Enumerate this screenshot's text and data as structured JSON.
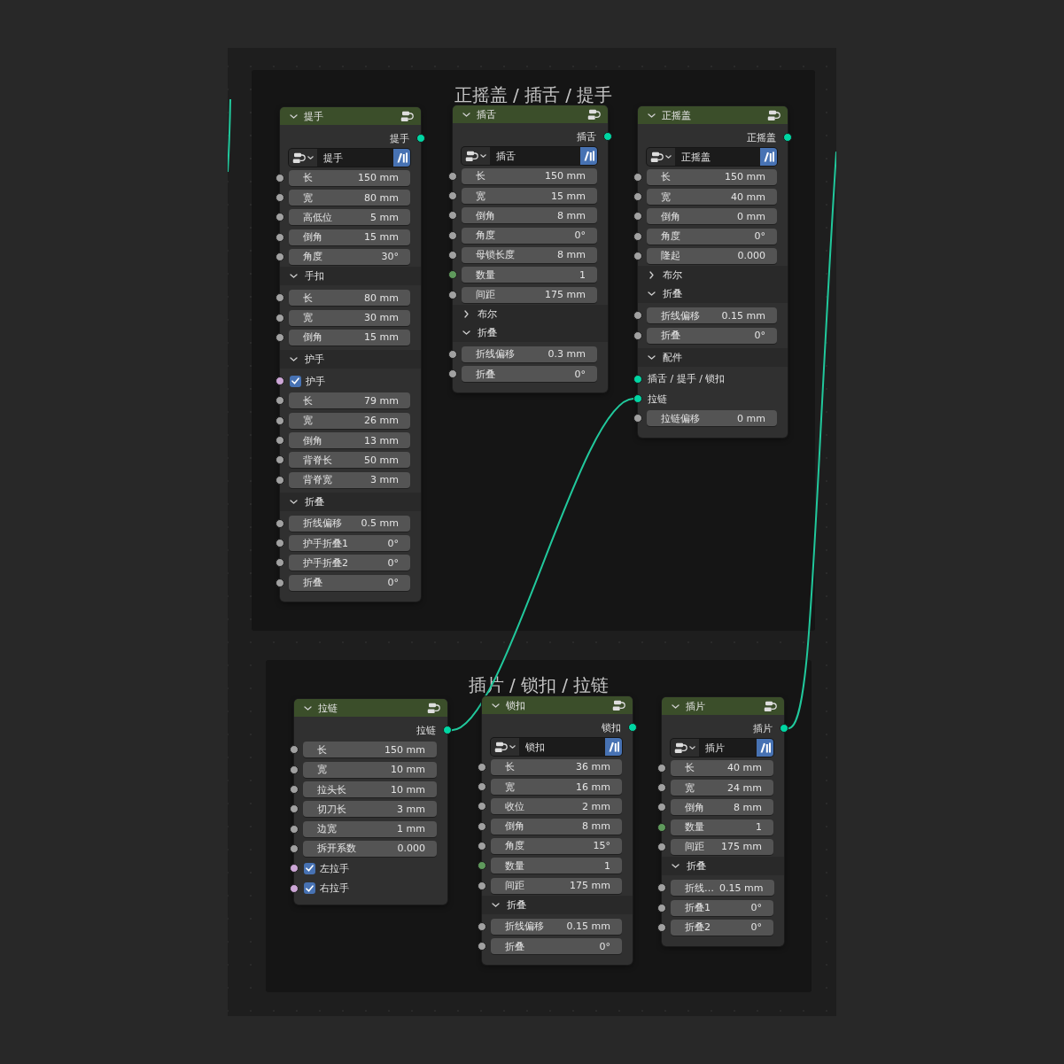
{
  "frames": [
    {
      "title": "正摇盖 / 插舌 / 提手",
      "nodes": [
        {
          "title": "提手",
          "expanded": true,
          "output": {
            "label": "提手",
            "color": "#00d6a3",
            "linked": false
          },
          "datablock": {
            "name": "提手",
            "asset": true
          },
          "items": [
            {
              "kind": "value",
              "label": "长",
              "value": "150 mm",
              "color": "#a1a1a1"
            },
            {
              "kind": "value",
              "label": "宽",
              "value": "80 mm",
              "color": "#a1a1a1"
            },
            {
              "kind": "value",
              "label": "高低位",
              "value": "5 mm",
              "color": "#a1a1a1"
            },
            {
              "kind": "value",
              "label": "倒角",
              "value": "15 mm",
              "color": "#a1a1a1"
            },
            {
              "kind": "value",
              "label": "角度",
              "value": "30°",
              "color": "#a1a1a1"
            },
            {
              "kind": "panel",
              "label": "手扣",
              "expanded": true,
              "children": [
                {
                  "kind": "value",
                  "label": "长",
                  "value": "80 mm",
                  "color": "#a1a1a1"
                },
                {
                  "kind": "value",
                  "label": "宽",
                  "value": "30 mm",
                  "color": "#a1a1a1"
                },
                {
                  "kind": "value",
                  "label": "倒角",
                  "value": "15 mm",
                  "color": "#a1a1a1"
                }
              ]
            },
            {
              "kind": "panel",
              "label": "护手",
              "expanded": true,
              "children": [
                {
                  "kind": "checkbox",
                  "label": "护手",
                  "checked": true,
                  "color": "#cca6d6"
                },
                {
                  "kind": "value",
                  "label": "长",
                  "value": "79 mm",
                  "color": "#a1a1a1"
                },
                {
                  "kind": "value",
                  "label": "宽",
                  "value": "26 mm",
                  "color": "#a1a1a1"
                },
                {
                  "kind": "value",
                  "label": "倒角",
                  "value": "13 mm",
                  "color": "#a1a1a1"
                },
                {
                  "kind": "value",
                  "label": "背脊长",
                  "value": "50 mm",
                  "color": "#a1a1a1"
                },
                {
                  "kind": "value",
                  "label": "背脊宽",
                  "value": "3 mm",
                  "color": "#a1a1a1"
                }
              ]
            },
            {
              "kind": "panel",
              "label": "折叠",
              "expanded": true,
              "children": [
                {
                  "kind": "value",
                  "label": "折线偏移",
                  "value": "0.5 mm",
                  "color": "#a1a1a1"
                },
                {
                  "kind": "value",
                  "label": "护手折叠1",
                  "value": "0°",
                  "color": "#a1a1a1"
                },
                {
                  "kind": "value",
                  "label": "护手折叠2",
                  "value": "0°",
                  "color": "#a1a1a1"
                },
                {
                  "kind": "value",
                  "label": "折叠",
                  "value": "0°",
                  "color": "#a1a1a1"
                }
              ]
            }
          ]
        },
        {
          "title": "插舌",
          "expanded": true,
          "output": {
            "label": "插舌",
            "color": "#00d6a3",
            "linked": false
          },
          "datablock": {
            "name": "插舌",
            "asset": true
          },
          "items": [
            {
              "kind": "value",
              "label": "长",
              "value": "150 mm",
              "color": "#a1a1a1"
            },
            {
              "kind": "value",
              "label": "宽",
              "value": "15 mm",
              "color": "#a1a1a1"
            },
            {
              "kind": "value",
              "label": "倒角",
              "value": "8 mm",
              "color": "#a1a1a1"
            },
            {
              "kind": "value",
              "label": "角度",
              "value": "0°",
              "color": "#a1a1a1"
            },
            {
              "kind": "value",
              "label": "母锁长度",
              "value": "8 mm",
              "color": "#a1a1a1"
            },
            {
              "kind": "value",
              "label": "数量",
              "value": "1",
              "color": "#5f9a5c"
            },
            {
              "kind": "value",
              "label": "间距",
              "value": "175 mm",
              "color": "#a1a1a1"
            },
            {
              "kind": "panel",
              "label": "布尔",
              "expanded": false
            },
            {
              "kind": "panel",
              "label": "折叠",
              "expanded": true,
              "children": [
                {
                  "kind": "value",
                  "label": "折线偏移",
                  "value": "0.3 mm",
                  "color": "#a1a1a1"
                },
                {
                  "kind": "value",
                  "label": "折叠",
                  "value": "0°",
                  "color": "#a1a1a1"
                }
              ]
            }
          ]
        },
        {
          "title": "正摇盖",
          "expanded": true,
          "output": {
            "label": "正摇盖",
            "color": "#00d6a3",
            "linked": false
          },
          "datablock": {
            "name": "正摇盖",
            "asset": true
          },
          "items": [
            {
              "kind": "value",
              "label": "长",
              "value": "150 mm",
              "color": "#a1a1a1"
            },
            {
              "kind": "value",
              "label": "宽",
              "value": "40 mm",
              "color": "#a1a1a1"
            },
            {
              "kind": "value",
              "label": "倒角",
              "value": "0 mm",
              "color": "#a1a1a1"
            },
            {
              "kind": "value",
              "label": "角度",
              "value": "0°",
              "color": "#a1a1a1"
            },
            {
              "kind": "value",
              "label": "隆起",
              "value": "0.000",
              "color": "#a1a1a1"
            },
            {
              "kind": "panel",
              "label": "布尔",
              "expanded": false
            },
            {
              "kind": "panel",
              "label": "折叠",
              "expanded": true,
              "children": [
                {
                  "kind": "value",
                  "label": "折线偏移",
                  "value": "0.15 mm",
                  "color": "#a1a1a1"
                },
                {
                  "kind": "value",
                  "label": "折叠",
                  "value": "0°",
                  "color": "#a1a1a1"
                }
              ]
            },
            {
              "kind": "panel",
              "label": "配件",
              "expanded": true,
              "children": [
                {
                  "kind": "socket",
                  "label": "插舌 / 提手 / 锁扣",
                  "color": "#00d6a3",
                  "linked": false
                },
                {
                  "kind": "socket",
                  "label": "拉链",
                  "color": "#00d6a3",
                  "linked": true
                },
                {
                  "kind": "value",
                  "label": "拉链偏移",
                  "value": "0 mm",
                  "color": "#a1a1a1"
                }
              ]
            }
          ]
        }
      ]
    },
    {
      "title": "插片 / 锁扣 / 拉链",
      "nodes": [
        {
          "title": "拉链",
          "expanded": true,
          "output": {
            "label": "拉链",
            "color": "#00d6a3",
            "linked": true
          },
          "items": [
            {
              "kind": "value",
              "label": "长",
              "value": "150 mm",
              "color": "#a1a1a1"
            },
            {
              "kind": "value",
              "label": "宽",
              "value": "10 mm",
              "color": "#a1a1a1"
            },
            {
              "kind": "value",
              "label": "拉头长",
              "value": "10 mm",
              "color": "#a1a1a1"
            },
            {
              "kind": "value",
              "label": "切刀长",
              "value": "3 mm",
              "color": "#a1a1a1"
            },
            {
              "kind": "value",
              "label": "边宽",
              "value": "1 mm",
              "color": "#a1a1a1"
            },
            {
              "kind": "value",
              "label": "拆开系数",
              "value": "0.000",
              "color": "#a1a1a1"
            },
            {
              "kind": "checkbox",
              "label": "左拉手",
              "checked": true,
              "color": "#cca6d6"
            },
            {
              "kind": "checkbox",
              "label": "右拉手",
              "checked": true,
              "color": "#cca6d6"
            }
          ]
        },
        {
          "title": "锁扣",
          "expanded": true,
          "output": {
            "label": "锁扣",
            "color": "#00d6a3",
            "linked": false
          },
          "datablock": {
            "name": "锁扣",
            "asset": true
          },
          "items": [
            {
              "kind": "value",
              "label": "长",
              "value": "36 mm",
              "color": "#a1a1a1"
            },
            {
              "kind": "value",
              "label": "宽",
              "value": "16 mm",
              "color": "#a1a1a1"
            },
            {
              "kind": "value",
              "label": "收位",
              "value": "2 mm",
              "color": "#a1a1a1"
            },
            {
              "kind": "value",
              "label": "倒角",
              "value": "8 mm",
              "color": "#a1a1a1"
            },
            {
              "kind": "value",
              "label": "角度",
              "value": "15°",
              "color": "#a1a1a1"
            },
            {
              "kind": "value",
              "label": "数量",
              "value": "1",
              "color": "#5f9a5c"
            },
            {
              "kind": "value",
              "label": "间距",
              "value": "175 mm",
              "color": "#a1a1a1"
            },
            {
              "kind": "panel",
              "label": "折叠",
              "expanded": true,
              "children": [
                {
                  "kind": "value",
                  "label": "折线偏移",
                  "value": "0.15 mm",
                  "color": "#a1a1a1"
                },
                {
                  "kind": "value",
                  "label": "折叠",
                  "value": "0°",
                  "color": "#a1a1a1"
                }
              ]
            }
          ]
        },
        {
          "title": "插片",
          "expanded": true,
          "output": {
            "label": "插片",
            "color": "#00d6a3",
            "linked": true
          },
          "datablock": {
            "name": "插片",
            "asset": true
          },
          "items": [
            {
              "kind": "value",
              "label": "长",
              "value": "40 mm",
              "color": "#a1a1a1"
            },
            {
              "kind": "value",
              "label": "宽",
              "value": "24 mm",
              "color": "#a1a1a1"
            },
            {
              "kind": "value",
              "label": "倒角",
              "value": "8 mm",
              "color": "#a1a1a1"
            },
            {
              "kind": "value",
              "label": "数量",
              "value": "1",
              "color": "#5f9a5c"
            },
            {
              "kind": "value",
              "label": "间距",
              "value": "175 mm",
              "color": "#a1a1a1"
            },
            {
              "kind": "panel",
              "label": "折叠",
              "expanded": true,
              "children": [
                {
                  "kind": "value",
                  "label": "折线…",
                  "value": "0.15 mm",
                  "color": "#a1a1a1"
                },
                {
                  "kind": "value",
                  "label": "折叠1",
                  "value": "0°",
                  "color": "#a1a1a1"
                },
                {
                  "kind": "value",
                  "label": "折叠2",
                  "value": "0°",
                  "color": "#a1a1a1"
                }
              ]
            }
          ]
        }
      ]
    }
  ],
  "stray_links": [
    {
      "kind": "left-edge"
    }
  ]
}
